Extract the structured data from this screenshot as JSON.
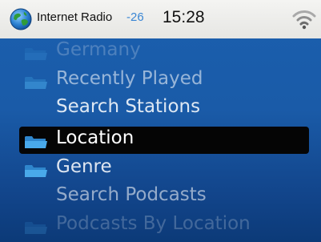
{
  "status_bar": {
    "app_title": "Internet Radio",
    "signal": "-26",
    "time": "15:28",
    "icons": [
      "globe-icon",
      "wifi-icon"
    ]
  },
  "menu": {
    "items": [
      {
        "label": "Germany",
        "icon": "folder-icon",
        "state": "faded"
      },
      {
        "label": "Recently Played",
        "icon": "folder-icon",
        "state": "partially-faded"
      },
      {
        "label": "Search Stations",
        "icon": "",
        "state": "normal"
      },
      {
        "label": "Location",
        "icon": "folder-icon",
        "state": "selected"
      },
      {
        "label": "Genre",
        "icon": "folder-icon",
        "state": "normal"
      },
      {
        "label": "Search Podcasts",
        "icon": "",
        "state": "partially-faded"
      },
      {
        "label": "Podcasts By Location",
        "icon": "folder-icon",
        "state": "faded"
      }
    ]
  },
  "colors": {
    "background": "#1a5ba8",
    "status_bar": "#ececea",
    "selection": "#050505",
    "signal_text": "#3a86d4",
    "folder": "#49a9ea"
  }
}
